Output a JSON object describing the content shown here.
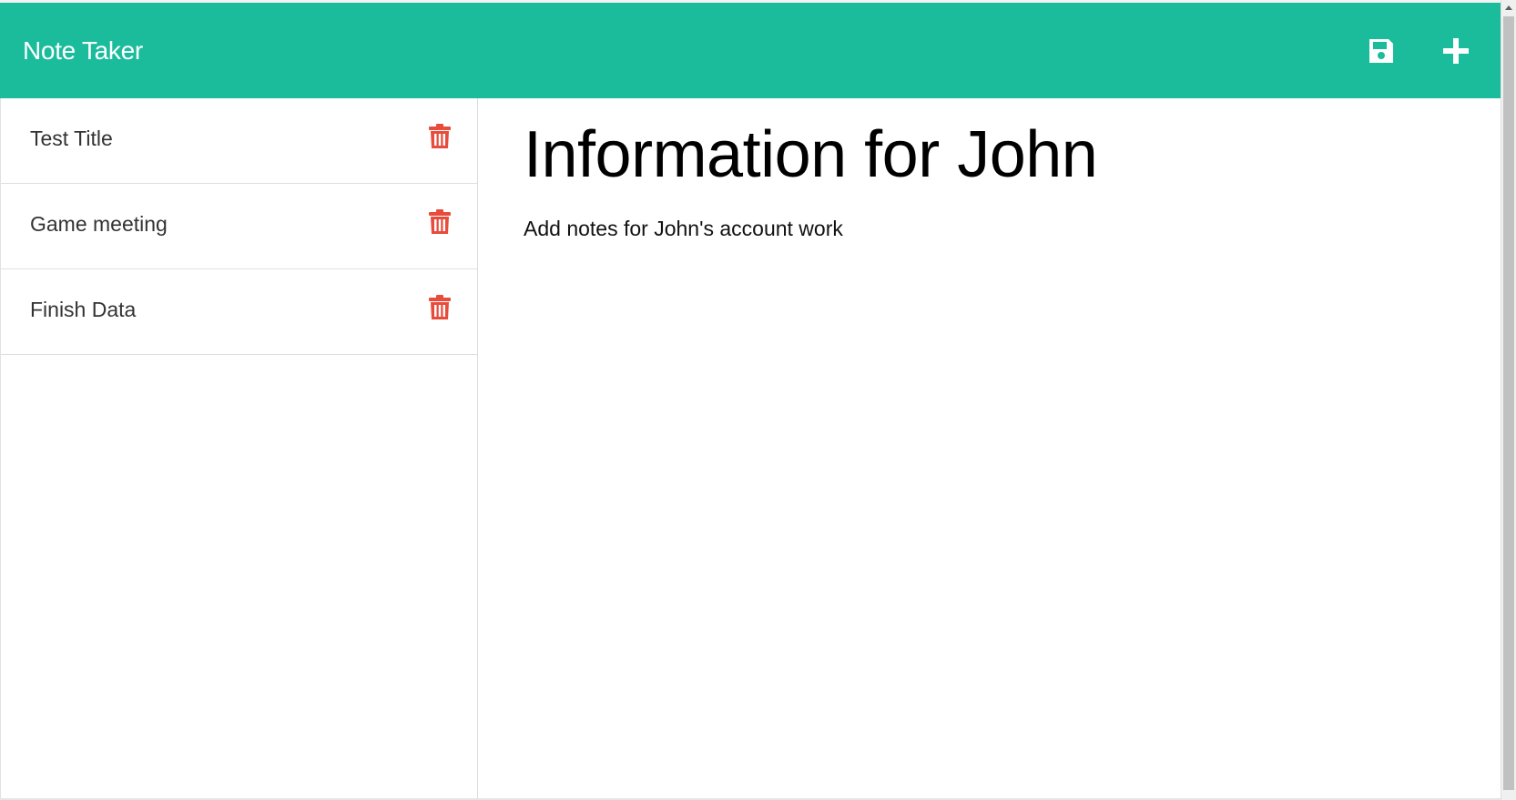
{
  "app": {
    "title": "Note Taker"
  },
  "colors": {
    "navbar": "#1abc9c",
    "nav_icon": "#ffffff",
    "trash": "#e74c3c",
    "text": "#333333"
  },
  "toolbar": {
    "save_icon": "floppy-disk",
    "new_icon": "plus"
  },
  "notes": [
    {
      "title": "Test Title",
      "icon": "trash"
    },
    {
      "title": "Game meeting",
      "icon": "trash"
    },
    {
      "title": "Finish Data",
      "icon": "trash"
    }
  ],
  "active_note": {
    "title": "Information for John",
    "text": "Add notes for John's account work"
  }
}
